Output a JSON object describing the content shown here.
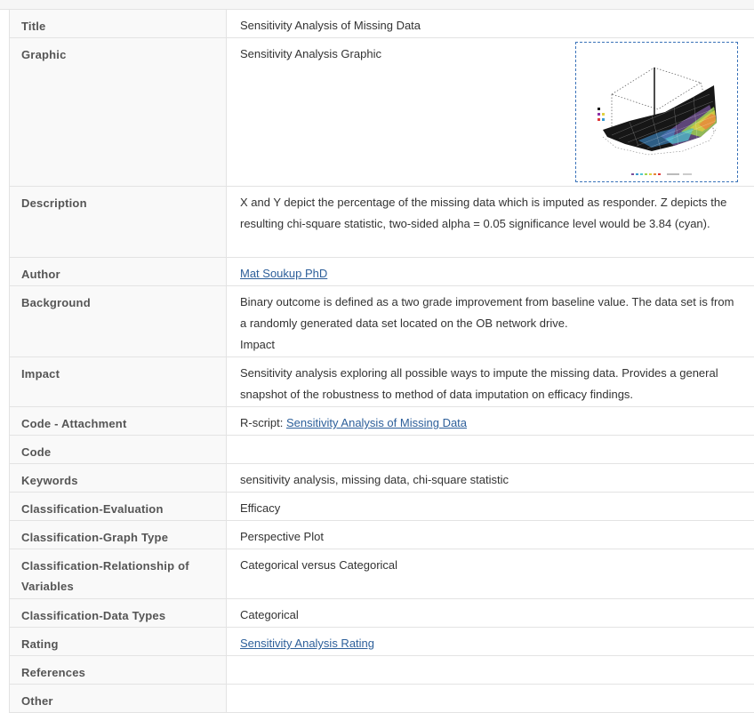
{
  "rows": {
    "title": {
      "label": "Title",
      "value": "Sensitivity Analysis of Missing Data"
    },
    "graphic": {
      "label": "Graphic",
      "value": "Sensitivity Analysis Graphic",
      "thumbnail": "perspective-plot-thumbnail"
    },
    "description": {
      "label": "Description",
      "value": "X and Y depict the percentage of the missing data which is imputed as responder. Z depicts the resulting chi-square statistic, two-sided alpha = 0.05 significance level would be 3.84 (cyan)."
    },
    "author": {
      "label": "Author",
      "link": "Mat Soukup PhD"
    },
    "background": {
      "label": "Background",
      "value": "Binary outcome is defined as a two grade improvement from baseline value. The data set is from a randomly generated data set located on the OB network drive.",
      "extra": "Impact"
    },
    "impact": {
      "label": "Impact",
      "value": "Sensitivity analysis exploring all possible ways to impute the missing data. Provides a general snapshot of the robustness to method of data imputation on efficacy findings."
    },
    "code_attachment": {
      "label": "Code - Attachment",
      "prefix": "R-script: ",
      "link": "Sensitivity Analysis of Missing Data"
    },
    "code": {
      "label": "Code",
      "value": ""
    },
    "keywords": {
      "label": "Keywords",
      "value": "sensitivity analysis, missing data, chi-square statistic"
    },
    "classification_evaluation": {
      "label": "Classification-Evaluation",
      "value": "Efficacy"
    },
    "classification_graph_type": {
      "label": "Classification-Graph Type",
      "value": "Perspective Plot"
    },
    "classification_relationship": {
      "label": "Classification-Relationship of Variables",
      "value": "Categorical versus Categorical"
    },
    "classification_data_types": {
      "label": "Classification-Data Types",
      "value": "Categorical"
    },
    "rating": {
      "label": "Rating",
      "link": "Sensitivity Analysis Rating"
    },
    "references": {
      "label": "References",
      "value": ""
    },
    "other": {
      "label": "Other",
      "value": ""
    }
  },
  "colors": {
    "link": "#2d5f9a",
    "border": "#e3e3e3",
    "label_bg": "#f9f9f9",
    "thumb_border": "#3b73b9"
  }
}
